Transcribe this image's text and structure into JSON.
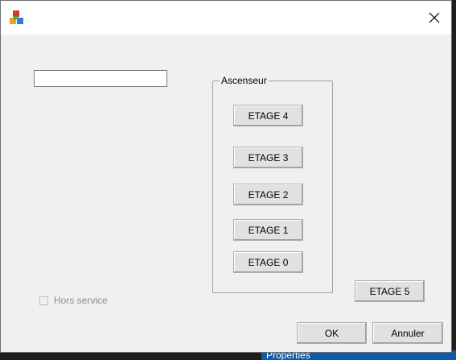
{
  "window": {
    "title": "",
    "app_icon": "app-cubes-icon",
    "close_icon": "close-icon"
  },
  "form": {
    "text_field_value": ""
  },
  "elevator": {
    "group_label": "Ascenseur",
    "buttons": [
      "ETAGE 4",
      "ETAGE 3",
      "ETAGE 2",
      "ETAGE 1",
      "ETAGE 0"
    ],
    "extra_button": "ETAGE 5"
  },
  "checkbox": {
    "label": "Hors service",
    "checked": false,
    "enabled": false
  },
  "footer": {
    "ok_label": "OK",
    "cancel_label": "Annuler"
  },
  "background": {
    "bottom_panel_label": "Properties"
  }
}
